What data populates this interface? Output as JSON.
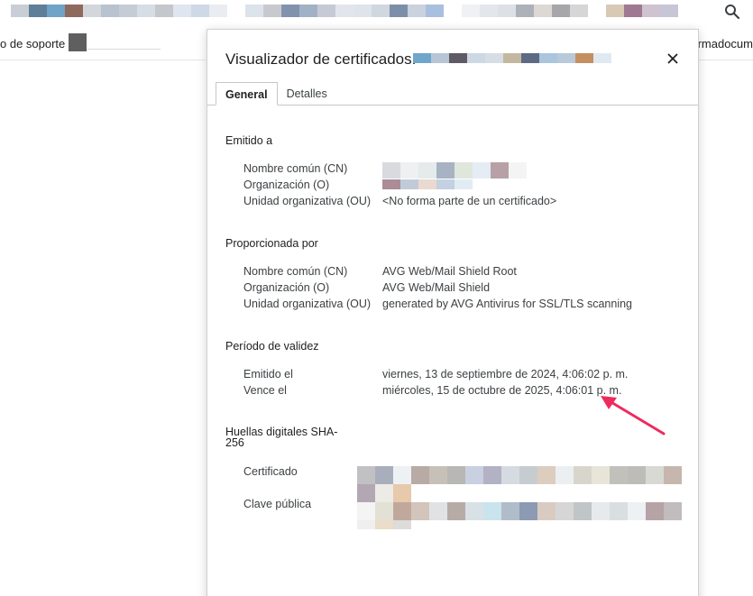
{
  "bookmarks": {
    "left_label": "o de soporte",
    "right_label": "firmadocum"
  },
  "dialog": {
    "title": "Visualizador de certificados:",
    "tabs": [
      {
        "label": "General",
        "active": true
      },
      {
        "label": "Detalles",
        "active": false
      }
    ],
    "issued_to": {
      "heading": "Emitido a",
      "cn_label": "Nombre común (CN)",
      "o_label": "Organización (O)",
      "ou_label": "Unidad organizativa (OU)",
      "ou_value": "<No forma parte de un certificado>"
    },
    "issued_by": {
      "heading": "Proporcionada por",
      "cn_label": "Nombre común (CN)",
      "cn_value": "AVG Web/Mail Shield Root",
      "o_label": "Organización (O)",
      "o_value": "AVG Web/Mail Shield",
      "ou_label": "Unidad organizativa (OU)",
      "ou_value": "generated by AVG Antivirus for SSL/TLS scanning"
    },
    "validity": {
      "heading": "Período de validez",
      "issued_label": "Emitido el",
      "issued_value": "viernes, 13 de septiembre de 2024, 4:06:02 p. m.",
      "expires_label": "Vence el",
      "expires_value": "miércoles, 15 de octubre de 2025, 4:06:01 p. m."
    },
    "fingerprints": {
      "heading": "Huellas digitales SHA-256",
      "cert_label": "Certificado",
      "pubkey_label": "Clave pública"
    }
  },
  "icons": {
    "search": "search-icon",
    "close": "close-icon",
    "annotation": "arrow-annotation-icon"
  },
  "colors": {
    "annotation_arrow": "#ee2b5d"
  }
}
